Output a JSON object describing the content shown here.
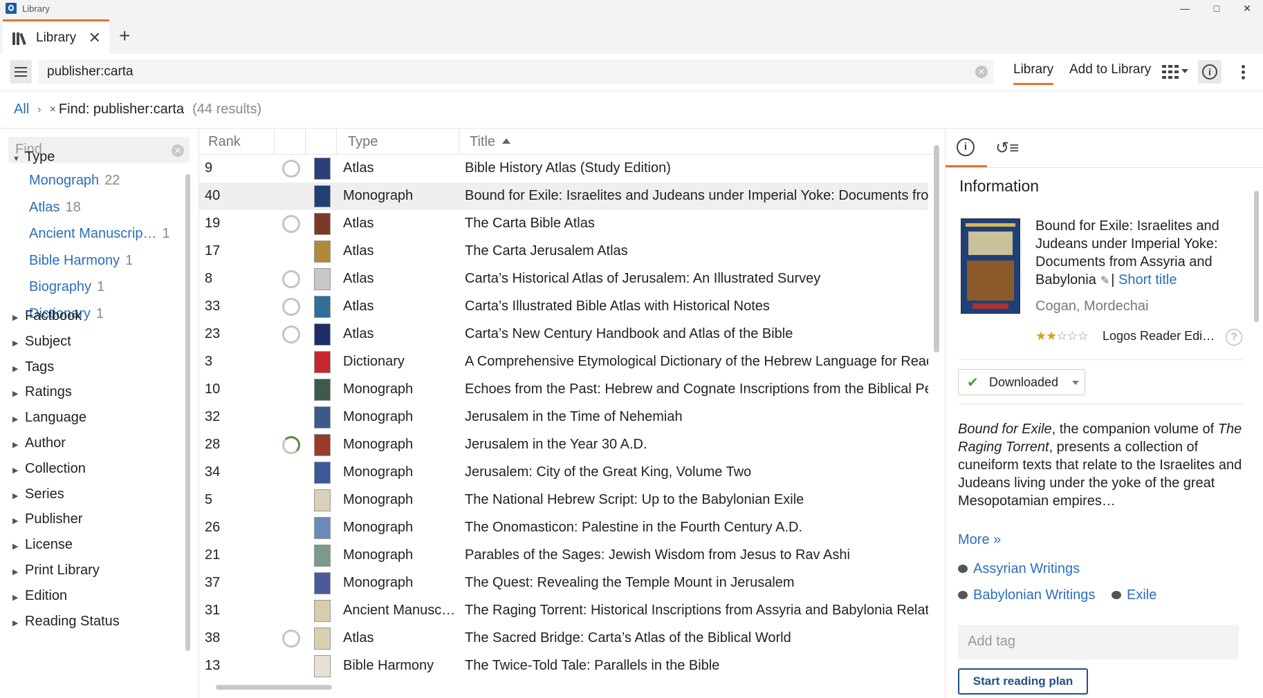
{
  "window": {
    "title": "Library"
  },
  "tab": {
    "label": "Library"
  },
  "search": {
    "value": "publisher:carta"
  },
  "toolbar": {
    "library_tab": "Library",
    "add_tab": "Add to Library"
  },
  "breadcrumb": {
    "all": "All",
    "find": "Find: publisher:carta",
    "count": "(44 results)"
  },
  "sidebar": {
    "find_placeholder": "Find",
    "type_heading": "Type",
    "type_items": [
      {
        "label": "Monograph",
        "count": "22"
      },
      {
        "label": "Atlas",
        "count": "18"
      },
      {
        "label": "Ancient Manuscrip…",
        "count": "1"
      },
      {
        "label": "Bible Harmony",
        "count": "1"
      },
      {
        "label": "Biography",
        "count": "1"
      },
      {
        "label": "Dictionary",
        "count": "1"
      }
    ],
    "facets": [
      "Factbook",
      "Subject",
      "Tags",
      "Ratings",
      "Language",
      "Author",
      "Collection",
      "Series",
      "Publisher",
      "License",
      "Print Library",
      "Edition",
      "Reading Status"
    ]
  },
  "list": {
    "headers": {
      "rank": "Rank",
      "type": "Type",
      "title": "Title"
    },
    "rows": [
      {
        "rank": "9",
        "type": "Atlas",
        "title": "Bible History Atlas (Study Edition)",
        "ring": "empty",
        "color": "#2d3f7a"
      },
      {
        "rank": "40",
        "type": "Monograph",
        "title": "Bound for Exile: Israelites and Judeans under Imperial Yoke: Documents from Assyria and Babylonia",
        "ring": "none",
        "color": "#1f3f77"
      },
      {
        "rank": "19",
        "type": "Atlas",
        "title": "The Carta Bible Atlas",
        "ring": "empty",
        "color": "#7a3a26"
      },
      {
        "rank": "17",
        "type": "Atlas",
        "title": "The Carta Jerusalem Atlas",
        "ring": "none",
        "color": "#b08a3a"
      },
      {
        "rank": "8",
        "type": "Atlas",
        "title": "Carta’s Historical Atlas of Jerusalem: An Illustrated Survey",
        "ring": "empty",
        "color": "#c8c8c8"
      },
      {
        "rank": "33",
        "type": "Atlas",
        "title": "Carta’s Illustrated Bible Atlas with Historical Notes",
        "ring": "empty",
        "color": "#2f6f9a"
      },
      {
        "rank": "23",
        "type": "Atlas",
        "title": "Carta’s New Century Handbook and Atlas of the Bible",
        "ring": "empty",
        "color": "#1d2d6a"
      },
      {
        "rank": "3",
        "type": "Dictionary",
        "title": "A Comprehensive Etymological Dictionary of the Hebrew Language for Readers of English",
        "ring": "none",
        "color": "#c8262c"
      },
      {
        "rank": "10",
        "type": "Monograph",
        "title": "Echoes from the Past: Hebrew and Cognate Inscriptions from the Biblical Period",
        "ring": "none",
        "color": "#3e5a4a"
      },
      {
        "rank": "32",
        "type": "Monograph",
        "title": "Jerusalem in the Time of Nehemiah",
        "ring": "none",
        "color": "#3a5a8a"
      },
      {
        "rank": "28",
        "type": "Monograph",
        "title": "Jerusalem in the Year 30 A.D.",
        "ring": "progress",
        "color": "#9a3a2a"
      },
      {
        "rank": "34",
        "type": "Monograph",
        "title": "Jerusalem: City of the Great King, Volume Two",
        "ring": "none",
        "color": "#3a5a9a"
      },
      {
        "rank": "5",
        "type": "Monograph",
        "title": "The National Hebrew Script: Up to the Babylonian Exile",
        "ring": "none",
        "color": "#d8d0b8"
      },
      {
        "rank": "26",
        "type": "Monograph",
        "title": "The Onomasticon: Palestine in the Fourth Century A.D.",
        "ring": "none",
        "color": "#6a8aba"
      },
      {
        "rank": "21",
        "type": "Monograph",
        "title": "Parables of the Sages: Jewish Wisdom from Jesus to Rav Ashi",
        "ring": "none",
        "color": "#7a9a8a"
      },
      {
        "rank": "37",
        "type": "Monograph",
        "title": "The Quest: Revealing the Temple Mount in Jerusalem",
        "ring": "none",
        "color": "#4a5a9a"
      },
      {
        "rank": "31",
        "type": "Ancient Manusc…",
        "title": "The Raging Torrent: Historical Inscriptions from Assyria and Babylonia Relating to Ancient Israel",
        "ring": "none",
        "color": "#d8ccaa"
      },
      {
        "rank": "38",
        "type": "Atlas",
        "title": "The Sacred Bridge: Carta’s Atlas of the Biblical World",
        "ring": "empty",
        "color": "#d8d0b0"
      },
      {
        "rank": "13",
        "type": "Bible Harmony",
        "title": "The Twice-Told Tale: Parallels in the Bible",
        "ring": "none",
        "color": "#e8e0d0"
      }
    ]
  },
  "panel": {
    "heading": "Information",
    "book_title": "Bound for Exile: Israelites and Judeans under Imperial Yoke: Documents from Assyria and Babylonia",
    "short_title_link": "Short title",
    "author": "Cogan, Mordechai",
    "rating": 2,
    "edition": "Logos Reader Edi…",
    "download_label": "Downloaded",
    "desc_title1": "Bound for Exile",
    "desc_text1": ", the companion volume of ",
    "desc_title2": "The Raging Torrent",
    "desc_text2": ", presents a collection of cuneiform texts that relate to the Israelites and Judeans living under the yoke of the great Mesopotamian empires…",
    "more_link": "More »",
    "topics": [
      "Assyrian Writings",
      "Babylonian Writings",
      "Exile"
    ],
    "add_tag_placeholder": "Add tag",
    "reading_plan_button": "Start reading plan"
  }
}
